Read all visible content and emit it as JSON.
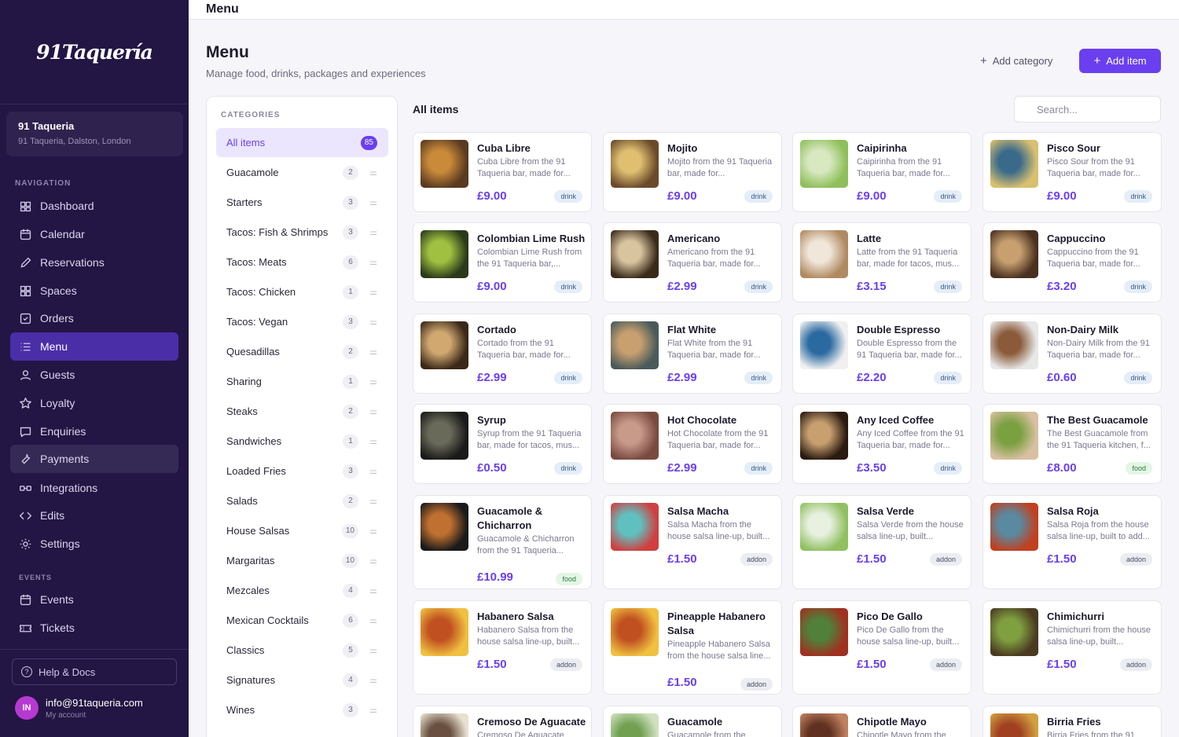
{
  "app": {
    "logo": "91Taquería",
    "topbar_title": "Menu"
  },
  "venue": {
    "name": "91 Taqueria",
    "address": "91 Taqueria, Dalston, London"
  },
  "nav": {
    "section_label": "NAVIGATION",
    "items": [
      {
        "label": "Dashboard",
        "icon": "home-icon"
      },
      {
        "label": "Calendar",
        "icon": "calendar-icon"
      },
      {
        "label": "Reservations",
        "icon": "pencil-icon"
      },
      {
        "label": "Spaces",
        "icon": "grid-icon"
      },
      {
        "label": "Orders",
        "icon": "checkbox-icon"
      },
      {
        "label": "Menu",
        "icon": "list-icon"
      },
      {
        "label": "Guests",
        "icon": "user-icon"
      },
      {
        "label": "Loyalty",
        "icon": "star-icon"
      },
      {
        "label": "Enquiries",
        "icon": "chat-icon"
      },
      {
        "label": "Payments",
        "icon": "wrench-icon"
      },
      {
        "label": "Integrations",
        "icon": "link-icon"
      },
      {
        "label": "Edits",
        "icon": "code-icon"
      },
      {
        "label": "Settings",
        "icon": "gear-icon"
      }
    ],
    "events_label": "EVENTS",
    "events": [
      {
        "label": "Events",
        "icon": "calendar-icon"
      },
      {
        "label": "Tickets",
        "icon": "ticket-icon"
      }
    ]
  },
  "footer": {
    "help": "Help & Docs",
    "email": "info@91taqueria.com",
    "account": "My account",
    "avatar_initials": "IN"
  },
  "header": {
    "title": "Menu",
    "subtitle": "Manage food, drinks, packages and experiences",
    "add_category": "Add category",
    "add_item": "Add item"
  },
  "categories": {
    "title": "CATEGORIES",
    "items": [
      {
        "label": "All items",
        "count": "85"
      },
      {
        "label": "Guacamole",
        "count": "2"
      },
      {
        "label": "Starters",
        "count": "3"
      },
      {
        "label": "Tacos: Fish & Shrimps",
        "count": "3"
      },
      {
        "label": "Tacos: Meats",
        "count": "6"
      },
      {
        "label": "Tacos: Chicken",
        "count": "1"
      },
      {
        "label": "Tacos: Vegan",
        "count": "3"
      },
      {
        "label": "Quesadillas",
        "count": "2"
      },
      {
        "label": "Sharing",
        "count": "1"
      },
      {
        "label": "Steaks",
        "count": "2"
      },
      {
        "label": "Sandwiches",
        "count": "1"
      },
      {
        "label": "Loaded Fries",
        "count": "3"
      },
      {
        "label": "Salads",
        "count": "2"
      },
      {
        "label": "House Salsas",
        "count": "10"
      },
      {
        "label": "Margaritas",
        "count": "10"
      },
      {
        "label": "Mezcales",
        "count": "4"
      },
      {
        "label": "Mexican Cocktails",
        "count": "6"
      },
      {
        "label": "Classics",
        "count": "5"
      },
      {
        "label": "Signatures",
        "count": "4"
      },
      {
        "label": "Wines",
        "count": "3"
      }
    ]
  },
  "items_panel": {
    "title": "All items",
    "search_placeholder": "Search..."
  },
  "items": [
    {
      "name": "Cuba Libre",
      "desc": "Cuba Libre from the 91 Taqueria bar, made for...",
      "price": "£9.00",
      "tag": "drink"
    },
    {
      "name": "Mojito",
      "desc": "Mojito from the 91 Taqueria bar, made for...",
      "price": "£9.00",
      "tag": "drink"
    },
    {
      "name": "Caipirinha",
      "desc": "Caipirinha from the 91 Taqueria bar, made for...",
      "price": "£9.00",
      "tag": "drink"
    },
    {
      "name": "Pisco Sour",
      "desc": "Pisco Sour from the 91 Taqueria bar, made for...",
      "price": "£9.00",
      "tag": "drink"
    },
    {
      "name": "Colombian Lime Rush",
      "desc": "Colombian Lime Rush from the 91 Taqueria bar,...",
      "price": "£9.00",
      "tag": "drink"
    },
    {
      "name": "Americano",
      "desc": "Americano from the 91 Taqueria bar, made for...",
      "price": "£2.99",
      "tag": "drink"
    },
    {
      "name": "Latte",
      "desc": "Latte from the 91 Taqueria bar, made for tacos, mus...",
      "price": "£3.15",
      "tag": "drink"
    },
    {
      "name": "Cappuccino",
      "desc": "Cappuccino from the 91 Taqueria bar, made for...",
      "price": "£3.20",
      "tag": "drink"
    },
    {
      "name": "Cortado",
      "desc": "Cortado from the 91 Taqueria bar, made for...",
      "price": "£2.99",
      "tag": "drink"
    },
    {
      "name": "Flat White",
      "desc": "Flat White from the 91 Taqueria bar, made for...",
      "price": "£2.99",
      "tag": "drink"
    },
    {
      "name": "Double Espresso",
      "desc": "Double Espresso from the 91 Taqueria bar, made for...",
      "price": "£2.20",
      "tag": "drink"
    },
    {
      "name": "Non-Dairy Milk",
      "desc": "Non-Dairy Milk from the 91 Taqueria bar, made for...",
      "price": "£0.60",
      "tag": "drink"
    },
    {
      "name": "Syrup",
      "desc": "Syrup from the 91 Taqueria bar, made for tacos, mus...",
      "price": "£0.50",
      "tag": "drink"
    },
    {
      "name": "Hot Chocolate",
      "desc": "Hot Chocolate from the 91 Taqueria bar, made for...",
      "price": "£2.99",
      "tag": "drink"
    },
    {
      "name": "Any Iced Coffee",
      "desc": "Any Iced Coffee from the 91 Taqueria bar, made for...",
      "price": "£3.50",
      "tag": "drink"
    },
    {
      "name": "The Best Guacamole",
      "desc": "The Best Guacamole from the 91 Taqueria kitchen, f...",
      "price": "£8.00",
      "tag": "food"
    },
    {
      "name": "Guacamole & Chicharron",
      "desc": "Guacamole & Chicharron from the 91 Taqueria...",
      "price": "£10.99",
      "tag": "food"
    },
    {
      "name": "Salsa Macha",
      "desc": "Salsa Macha from the house salsa line-up, built...",
      "price": "£1.50",
      "tag": "addon"
    },
    {
      "name": "Salsa Verde",
      "desc": "Salsa Verde from the house salsa line-up, built...",
      "price": "£1.50",
      "tag": "addon"
    },
    {
      "name": "Salsa Roja",
      "desc": "Salsa Roja from the house salsa line-up, built to add...",
      "price": "£1.50",
      "tag": "addon"
    },
    {
      "name": "Habanero Salsa",
      "desc": "Habanero Salsa from the house salsa line-up, built...",
      "price": "£1.50",
      "tag": "addon"
    },
    {
      "name": "Pineapple Habanero Salsa",
      "desc": "Pineapple Habanero Salsa from the house salsa line...",
      "price": "£1.50",
      "tag": "addon"
    },
    {
      "name": "Pico De Gallo",
      "desc": "Pico De Gallo from the house salsa line-up, built...",
      "price": "£1.50",
      "tag": "addon"
    },
    {
      "name": "Chimichurri",
      "desc": "Chimichurri from the house salsa line-up, built...",
      "price": "£1.50",
      "tag": "addon"
    },
    {
      "name": "Cremoso De Aguacate",
      "desc": "Cremoso De Aguacate",
      "price": "",
      "tag": ""
    },
    {
      "name": "Guacamole",
      "desc": "Guacamole from the",
      "price": "",
      "tag": ""
    },
    {
      "name": "Chipotle Mayo",
      "desc": "Chipotle Mayo from the",
      "price": "",
      "tag": ""
    },
    {
      "name": "Birria Fries",
      "desc": "Birria Fries from the 91",
      "price": "",
      "tag": ""
    }
  ],
  "colors": {
    "brand": "#6a3ff0",
    "sidebar": "#231544",
    "active_nav": "#4a2ea8"
  }
}
